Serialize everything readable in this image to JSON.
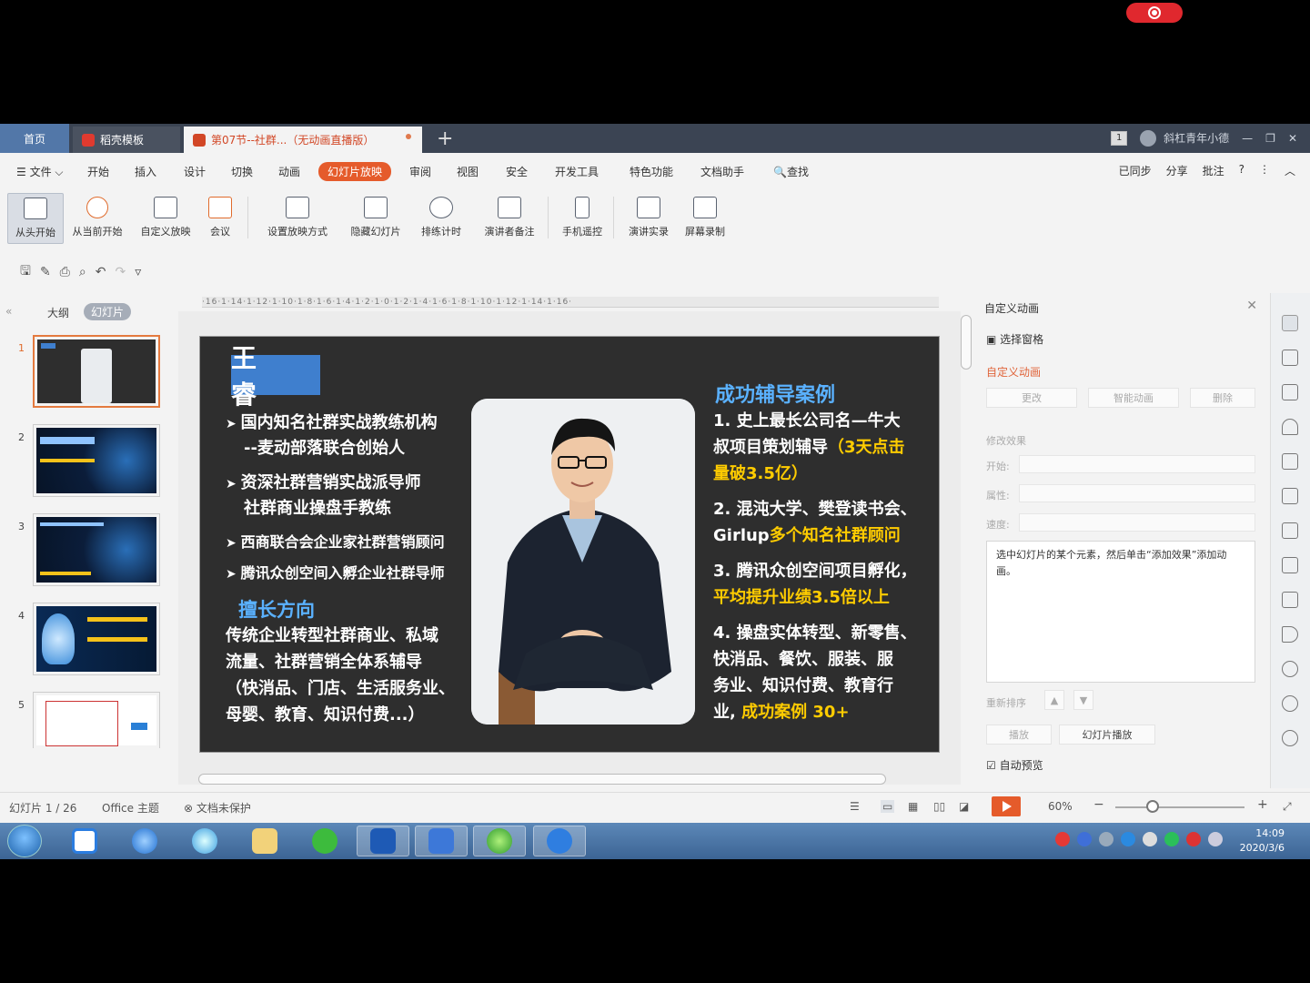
{
  "tabs": {
    "home": "首页",
    "template": "稻壳模板",
    "document": "第07节--社群...（无动画直播版）"
  },
  "titlebar": {
    "page_badge": "1",
    "user": "斜杠青年小德"
  },
  "menu": {
    "file": "文件",
    "items": [
      "开始",
      "插入",
      "设计",
      "切换",
      "动画",
      "幻灯片放映",
      "审阅",
      "视图",
      "安全",
      "开发工具",
      "特色功能",
      "文档助手",
      "查找"
    ],
    "right": [
      "已同步",
      "分享",
      "批注",
      "?"
    ]
  },
  "ribbon": {
    "buttons": [
      "从头开始",
      "从当前开始",
      "自定义放映",
      "会议",
      "设置放映方式",
      "隐藏幻灯片",
      "排练计时",
      "演讲者备注",
      "手机遥控",
      "演讲实录",
      "屏幕录制"
    ]
  },
  "left_panel": {
    "tab_outline": "大纲",
    "tab_slides": "幻灯片",
    "slide_numbers": [
      "1",
      "2",
      "3",
      "4",
      "5"
    ]
  },
  "ruler_text": "·16·1·14·1·12·1·10·1·8·1·6·1·4·1·2·1·0·1·2·1·4·1·6·1·8·1·10·1·12·1·14·1·16·",
  "slide": {
    "name": "王 睿",
    "bullets": [
      "国内知名社群实战教练机构",
      "--麦动部落联合创始人",
      "资深社群营销实战派导师",
      "社群商业操盘手教练",
      "西商联合会企业家社群营销顾问",
      "腾讯众创空间入孵企业社群导师"
    ],
    "expertise_title": "擅长方向",
    "expertise_lines": [
      "传统企业转型社群商业、私域",
      "流量、社群营销全体系辅导",
      "（快消品、门店、生活服务业、",
      "母婴、教育、知识付费...）"
    ],
    "cases_title": "成功辅导案例",
    "case1_a": "1. 史上最长公司名—牛大",
    "case1_b": "叔项目策划辅导",
    "case1_hl1": "（3天点击",
    "case1_hl2": "量破3.5亿）",
    "case2_a": "2. 混沌大学、樊登读书会、",
    "case2_b": "Girlup",
    "case2_hl": "多个知名社群顾问",
    "case3_a": "3. 腾讯众创空间项目孵化，",
    "case3_hl": "平均提升业绩3.5倍以上",
    "case4_a": "4. 操盘实体转型、新零售、",
    "case4_b": "快消品、餐饮、服装、服",
    "case4_c": "务业、知识付费、教育行",
    "case4_d": "业,",
    "case4_hl": "成功案例 30+"
  },
  "right_panel": {
    "title": "自定义动画",
    "select_pane": "选择窗格",
    "section": "自定义动画",
    "btn_change": "更改",
    "btn_smart": "智能动画",
    "btn_delete": "删除",
    "modify": "修改效果",
    "label_start": "开始:",
    "label_prop": "属性:",
    "label_speed": "速度:",
    "hint": "选中幻灯片的某个元素，然后单击“添加效果”添加动画。",
    "reorder": "重新排序",
    "btn_play": "播放",
    "btn_slideshow": "幻灯片播放",
    "autopreview": "自动预览"
  },
  "status": {
    "slide_info": "幻灯片 1 / 26",
    "theme": "Office 主题",
    "protect": "文档未保护",
    "zoom": "60%"
  },
  "clock": {
    "time": "14:09",
    "date": "2020/3/6"
  }
}
